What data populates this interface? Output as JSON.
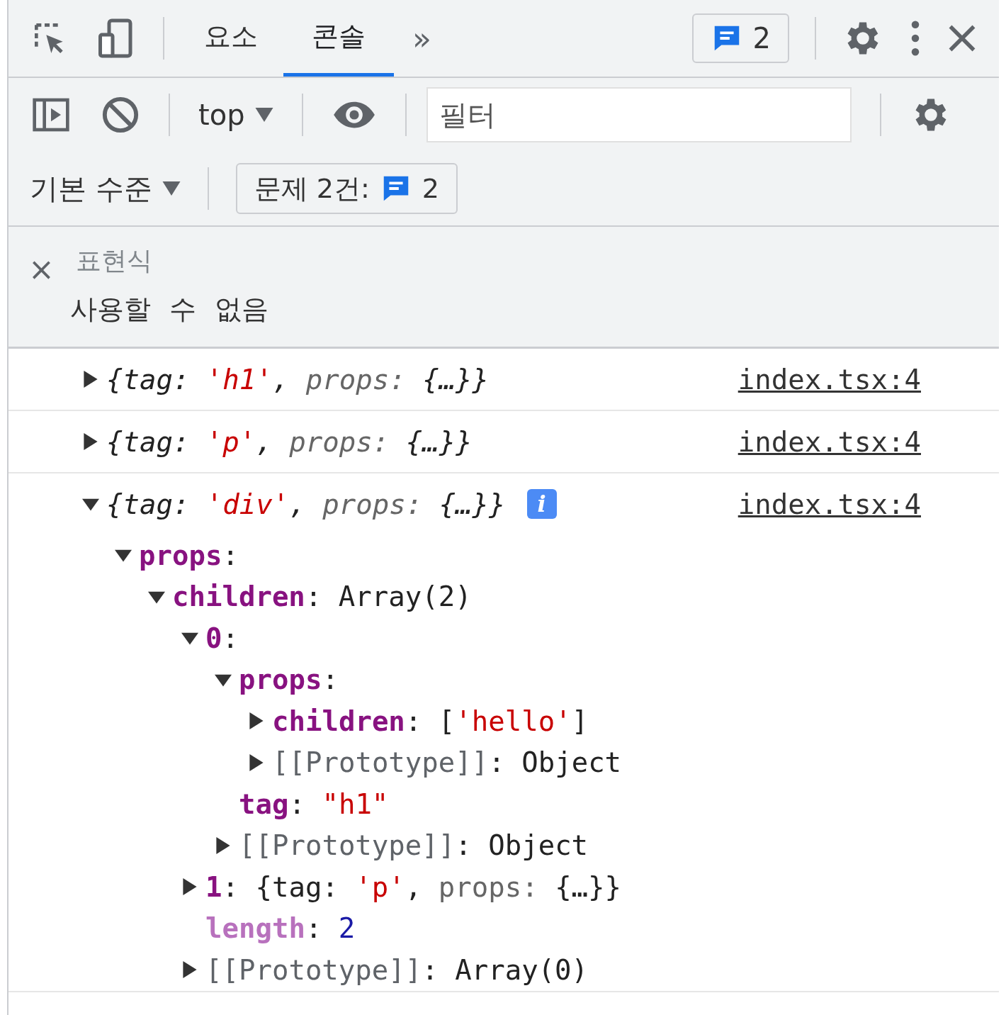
{
  "toolbar": {
    "tabs": [
      {
        "label": "요소",
        "selected": false
      },
      {
        "label": "콘솔",
        "selected": true
      }
    ],
    "more": "»",
    "issues_badge": "2"
  },
  "console_toolbar": {
    "context": "top",
    "filter_placeholder": "필터",
    "level": "기본 수준",
    "issues_label": "문제 2건:",
    "issues_count": "2"
  },
  "live_expression": {
    "close": "×",
    "label": "표현식",
    "value": "사용할 수 없음"
  },
  "messages": [
    {
      "expanded": false,
      "source": "index.tsx:4",
      "summary": [
        {
          "text": "{tag: ",
          "kind": "plain"
        },
        {
          "text": "'h1'",
          "kind": "string"
        },
        {
          "text": ", ",
          "kind": "plain"
        },
        {
          "text": "props: ",
          "kind": "dim"
        },
        {
          "text": "{…}}",
          "kind": "plain"
        }
      ]
    },
    {
      "expanded": false,
      "source": "index.tsx:4",
      "summary": [
        {
          "text": "{tag: ",
          "kind": "plain"
        },
        {
          "text": "'p'",
          "kind": "string"
        },
        {
          "text": ", ",
          "kind": "plain"
        },
        {
          "text": "props: ",
          "kind": "dim"
        },
        {
          "text": "{…}}",
          "kind": "plain"
        }
      ]
    },
    {
      "expanded": true,
      "info": "i",
      "source": "index.tsx:4",
      "summary": [
        {
          "text": "{tag: ",
          "kind": "plain"
        },
        {
          "text": "'div'",
          "kind": "string"
        },
        {
          "text": ", ",
          "kind": "plain"
        },
        {
          "text": "props: ",
          "kind": "dim"
        },
        {
          "text": "{…}}",
          "kind": "plain"
        }
      ],
      "children": [
        {
          "key": "props",
          "kind": "own",
          "expanded": true,
          "value": [
            {
              "text": ":",
              "kind": "plain"
            }
          ],
          "children": [
            {
              "key": "children",
              "kind": "own",
              "expanded": true,
              "value": [
                {
                  "text": ": ",
                  "kind": "plain"
                },
                {
                  "text": "Array(2)",
                  "kind": "plain"
                }
              ],
              "children": [
                {
                  "key": "0",
                  "kind": "own",
                  "expanded": true,
                  "value": [
                    {
                      "text": ":",
                      "kind": "plain"
                    }
                  ],
                  "children": [
                    {
                      "key": "props",
                      "kind": "own",
                      "expanded": true,
                      "value": [
                        {
                          "text": ":",
                          "kind": "plain"
                        }
                      ],
                      "children": [
                        {
                          "key": "children",
                          "kind": "own",
                          "expanded": false,
                          "value": [
                            {
                              "text": ": ",
                              "kind": "plain"
                            },
                            {
                              "text": "[",
                              "kind": "plain"
                            },
                            {
                              "text": "'hello'",
                              "kind": "string"
                            },
                            {
                              "text": "]",
                              "kind": "plain"
                            }
                          ]
                        },
                        {
                          "key": "[[Prototype]]",
                          "kind": "internal",
                          "expanded": false,
                          "value": [
                            {
                              "text": ": ",
                              "kind": "plain"
                            },
                            {
                              "text": "Object",
                              "kind": "plain"
                            }
                          ]
                        }
                      ]
                    },
                    {
                      "key": "tag",
                      "kind": "own",
                      "value": [
                        {
                          "text": ": ",
                          "kind": "plain"
                        },
                        {
                          "text": "\"h1\"",
                          "kind": "string"
                        }
                      ]
                    },
                    {
                      "key": "[[Prototype]]",
                      "kind": "internal",
                      "expanded": false,
                      "value": [
                        {
                          "text": ": ",
                          "kind": "plain"
                        },
                        {
                          "text": "Object",
                          "kind": "plain"
                        }
                      ]
                    }
                  ]
                },
                {
                  "key": "1",
                  "kind": "own",
                  "expanded": false,
                  "value": [
                    {
                      "text": ": ",
                      "kind": "plain"
                    },
                    {
                      "text": "{tag: ",
                      "kind": "plain"
                    },
                    {
                      "text": "'p'",
                      "kind": "string"
                    },
                    {
                      "text": ", ",
                      "kind": "plain"
                    },
                    {
                      "text": "props: ",
                      "kind": "dim"
                    },
                    {
                      "text": "{…}}",
                      "kind": "plain"
                    }
                  ]
                },
                {
                  "key": "length",
                  "kind": "nonenum",
                  "value": [
                    {
                      "text": ": ",
                      "kind": "plain"
                    },
                    {
                      "text": "2",
                      "kind": "number"
                    }
                  ]
                },
                {
                  "key": "[[Prototype]]",
                  "kind": "internal",
                  "expanded": false,
                  "value": [
                    {
                      "text": ": ",
                      "kind": "plain"
                    },
                    {
                      "text": "Array(0)",
                      "kind": "plain"
                    }
                  ]
                }
              ]
            }
          ]
        }
      ]
    }
  ]
}
